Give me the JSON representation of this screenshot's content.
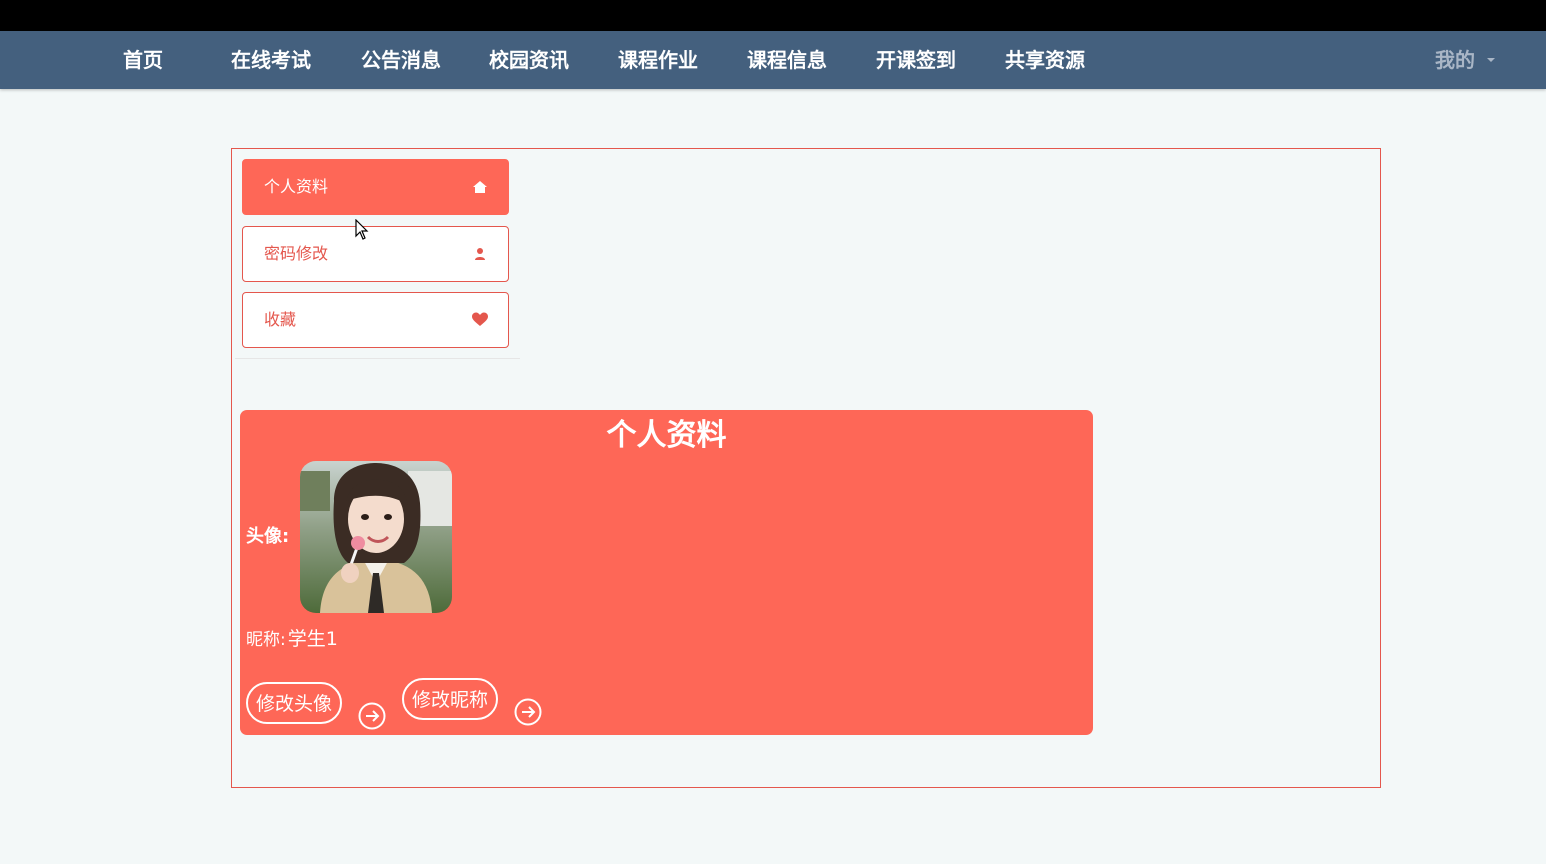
{
  "nav": {
    "items": [
      "首页",
      "在线考试",
      "公告消息",
      "校园资讯",
      "课程作业",
      "课程信息",
      "开课签到",
      "共享资源"
    ],
    "mine_label": "我的"
  },
  "side_menu": {
    "items": [
      {
        "label": "个人资料",
        "icon": "home-icon",
        "active": true
      },
      {
        "label": "密码修改",
        "icon": "user-icon",
        "active": false
      },
      {
        "label": "收藏",
        "icon": "heart-icon",
        "active": false
      }
    ]
  },
  "profile": {
    "title": "个人资料",
    "avatar_label": "头像:",
    "nickname_label": "昵称:",
    "nickname_value": "学生1",
    "change_avatar_button": "修改头像",
    "change_nickname_button": "修改昵称"
  },
  "colors": {
    "accent": "#fe6757",
    "navbar": "#44607e",
    "page_bg": "#f3f8f8"
  }
}
